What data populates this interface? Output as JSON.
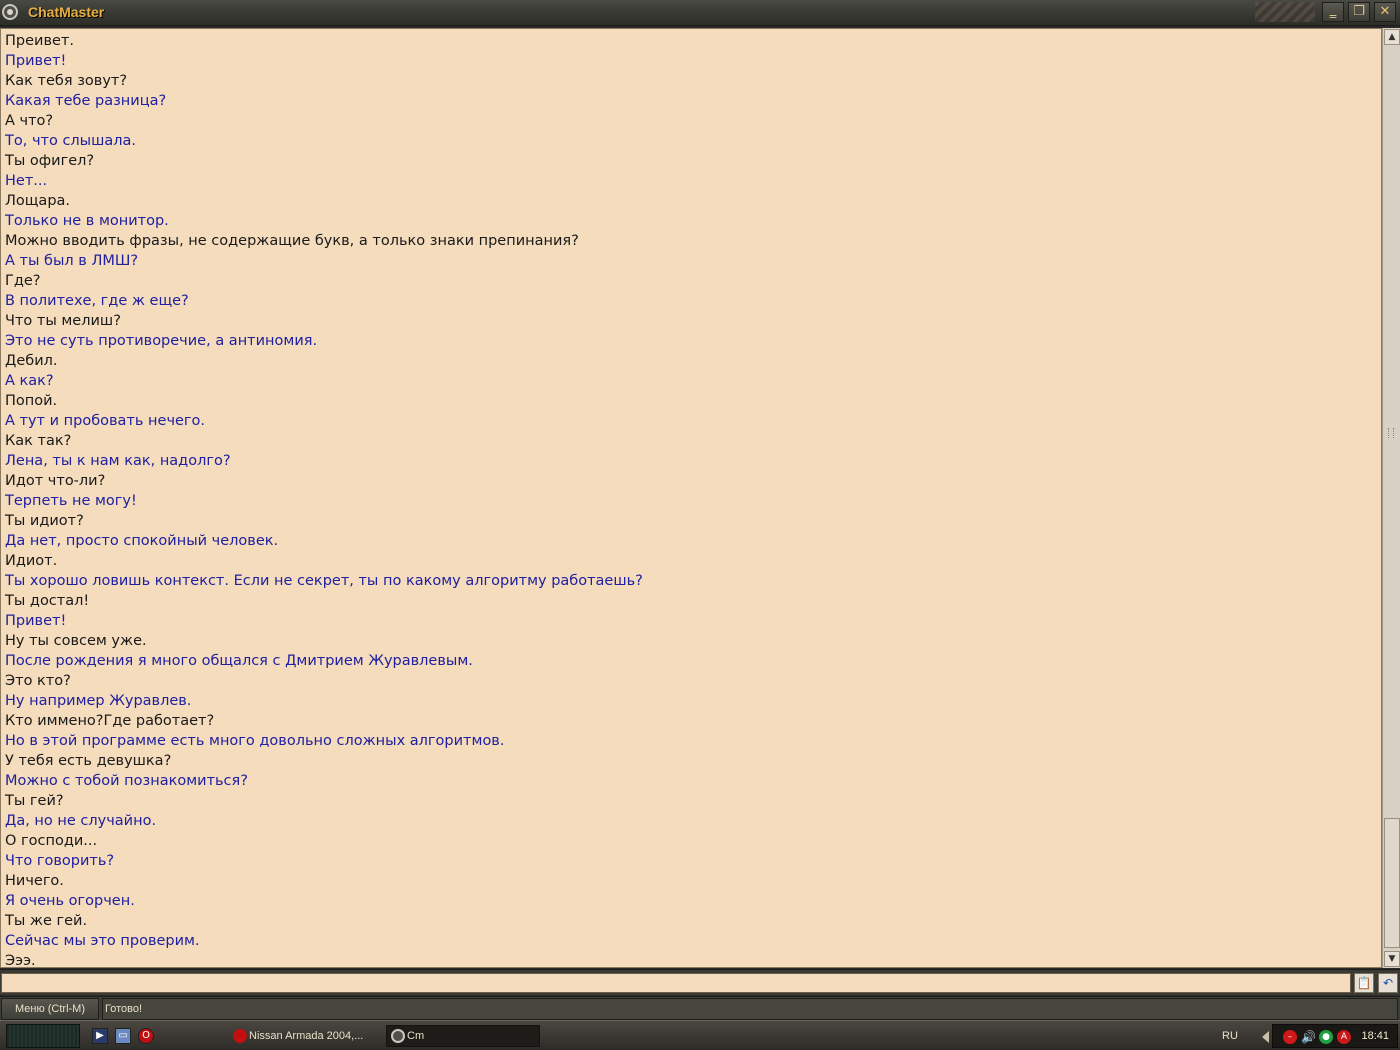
{
  "window": {
    "title": "ChatMaster",
    "minimize_label": "‗",
    "maximize_label": "❐",
    "close_label": "✕"
  },
  "chat": {
    "messages": [
      {
        "who": "user",
        "text": "Преивет."
      },
      {
        "who": "bot",
        "text": "Привет!"
      },
      {
        "who": "user",
        "text": "Как тебя зовут?"
      },
      {
        "who": "bot",
        "text": "Какая тебе разница?"
      },
      {
        "who": "user",
        "text": "А что?"
      },
      {
        "who": "bot",
        "text": "То, что слышала."
      },
      {
        "who": "user",
        "text": "Ты офигел?"
      },
      {
        "who": "bot",
        "text": "Нет..."
      },
      {
        "who": "user",
        "text": "Лощара."
      },
      {
        "who": "bot",
        "text": "Только не в монитор."
      },
      {
        "who": "user",
        "text": "Можно вводить фразы, не содержащие букв, а только знаки препинания?"
      },
      {
        "who": "bot",
        "text": "А ты был в ЛМШ?"
      },
      {
        "who": "user",
        "text": "Где?"
      },
      {
        "who": "bot",
        "text": "В политехе, где ж еще?"
      },
      {
        "who": "user",
        "text": "Что ты мелиш?"
      },
      {
        "who": "bot",
        "text": "Это не суть противоречие, а антиномия."
      },
      {
        "who": "user",
        "text": "Дебил."
      },
      {
        "who": "bot",
        "text": "А как?"
      },
      {
        "who": "user",
        "text": "Попой."
      },
      {
        "who": "bot",
        "text": "А тут и пробовать нечего."
      },
      {
        "who": "user",
        "text": "Как так?"
      },
      {
        "who": "bot",
        "text": "Лена, ты к нам как, надолго?"
      },
      {
        "who": "user",
        "text": "Идот что-ли?"
      },
      {
        "who": "bot",
        "text": "Терпеть не могу!"
      },
      {
        "who": "user",
        "text": "Ты идиот?"
      },
      {
        "who": "bot",
        "text": "Да нет, просто спокойный человек."
      },
      {
        "who": "user",
        "text": "Идиот."
      },
      {
        "who": "bot",
        "text": "Ты хорошо ловишь контекст. Если не секрет, ты по какому алгоритму работаешь?"
      },
      {
        "who": "user",
        "text": "Ты достал!"
      },
      {
        "who": "bot",
        "text": "Привет!"
      },
      {
        "who": "user",
        "text": "Ну ты совсем уже."
      },
      {
        "who": "bot",
        "text": "После рождения я много общался с Дмитрием Журавлевым."
      },
      {
        "who": "user",
        "text": "Это кто?"
      },
      {
        "who": "bot",
        "text": "Ну например Журавлев."
      },
      {
        "who": "user",
        "text": "Кто иммено?Где работает?"
      },
      {
        "who": "bot",
        "text": "Но в этой программе есть много довольно сложных алгоритмов."
      },
      {
        "who": "user",
        "text": "У тебя есть девушка?"
      },
      {
        "who": "bot",
        "text": "Можно с тобой познакомиться?"
      },
      {
        "who": "user",
        "text": "Ты гей?"
      },
      {
        "who": "bot",
        "text": "Да, но не случайно."
      },
      {
        "who": "user",
        "text": "О господи..."
      },
      {
        "who": "bot",
        "text": "Что говорить?"
      },
      {
        "who": "user",
        "text": "Ничего."
      },
      {
        "who": "bot",
        "text": "Я очень огорчен."
      },
      {
        "who": "user",
        "text": "Ты же гей."
      },
      {
        "who": "bot",
        "text": "Сейчас мы это проверим."
      },
      {
        "who": "user",
        "text": "Эээ."
      }
    ]
  },
  "input": {
    "value": "",
    "paste_icon": "paste-icon",
    "undo_icon": "undo-icon"
  },
  "statusbar": {
    "menu_label": "Меню (Ctrl-M)",
    "status_text": "Готово!"
  },
  "taskbar": {
    "tasks": [
      {
        "label": "Nissan Armada 2004,...",
        "icon": "opera-icon"
      },
      {
        "label": "Cm",
        "icon": "chatmaster-icon"
      }
    ],
    "language": "RU",
    "clock": "18:41"
  },
  "colors": {
    "chat_background": "#f5dcbd",
    "user_text": "#1a1a1a",
    "bot_text": "#2020a0",
    "title_text": "#e8b040"
  }
}
